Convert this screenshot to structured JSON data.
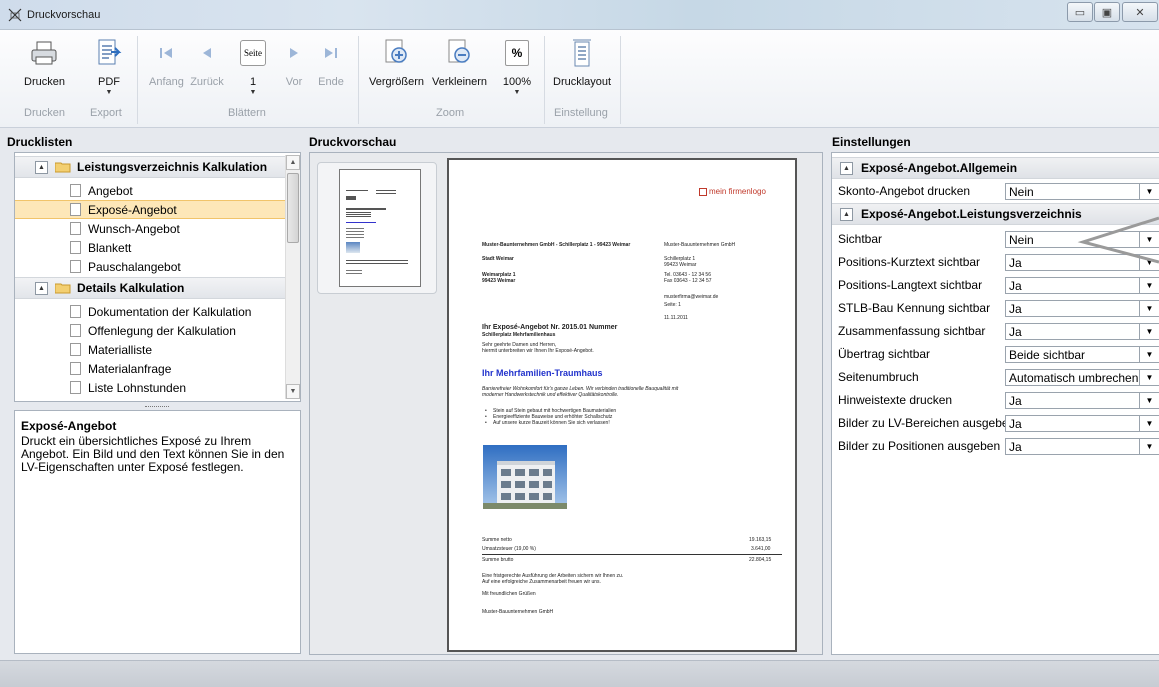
{
  "window": {
    "title": "Druckvorschau"
  },
  "ribbon": {
    "drucken": "Drucken",
    "pdf": "PDF",
    "anfang": "Anfang",
    "zurueck": "Zurück",
    "seite_icon": "Seite",
    "seite_value": "1",
    "vor": "Vor",
    "ende": "Ende",
    "vergroessern": "Vergrößern",
    "verkleinern": "Verkleinern",
    "zoom_icon": "%",
    "zoom_value": "100%",
    "drucklayout": "Drucklayout",
    "groups": {
      "drucken": "Drucken",
      "export": "Export",
      "blaettern": "Blättern",
      "zoom": "Zoom",
      "einstellung": "Einstellung"
    }
  },
  "drucklisten": {
    "title": "Drucklisten",
    "group1": "Leistungsverzeichnis Kalkulation",
    "group1_items": [
      "Angebot",
      "Exposé-Angebot",
      "Wunsch-Angebot",
      "Blankett",
      "Pauschalangebot"
    ],
    "group2": "Details Kalkulation",
    "group2_items": [
      "Dokumentation der Kalkulation",
      "Offenlegung der Kalkulation",
      "Materialliste",
      "Materialanfrage",
      "Liste Lohnstunden"
    ]
  },
  "description": {
    "title": "Exposé-Angebot",
    "text": "Druckt ein übersichtliches Exposé zu Ihrem Angebot. Ein Bild und den Text können Sie in den LV-Eigenschaften unter Exposé festlegen."
  },
  "preview": {
    "title": "Druckvorschau",
    "logo": "mein firmenlogo",
    "sender_line": "Muster-Baunternehmen GmbH - Schillerplatz 1 - 99423 Weimar",
    "company": "Muster-Bauunternehmen GmbH",
    "addr_street": "Schillerplatz 1",
    "addr_city": "99423 Weimar",
    "tel": "Tel.   03643 - 12 34 56",
    "fax": "Fax    03643 - 12 34 57",
    "email": "musterfirma@weimar.de",
    "page": "Seite: 1",
    "date": "11.11.2011",
    "recipient1": "Stadt Weimar",
    "recipient2": "Weimarplatz 1",
    "recipient3": "99423 Weimar",
    "offer_title": "Ihr Exposé-Angebot Nr. 2015.01 Nummer",
    "offer_sub": "Schillerplatz Mehrfamilienhaus",
    "salutation": "Sehr geehrte Damen und Herren,",
    "intro": "hiermit unterbreiten wir Ihnen Ihr Exposé-Angebot.",
    "headline": "Ihr Mehrfamilien-Traumhaus",
    "body1": "Barrierefreier Wohnkomfort für's ganze Leben. Wir verbinden traditionelle Bauqualität mit",
    "body2": "moderner Handwerkstechnik und effektiver Qualitätskontrolle.",
    "bullets": [
      "Stein auf Stein gebaut mit hochwertigen Baumaterialien",
      "Energieeffiziente Bauweise und erhöhter Schallschutz",
      "Auf unsere kurze Bauzeit können Sie sich verlassen!"
    ],
    "sum_net_label": "Summe netto",
    "sum_net": "19.163,15",
    "vat_label": "Umsatzsteuer (19,00 %)",
    "vat": "3.641,00",
    "sum_gross_label": "Summe brutto",
    "sum_gross": "22.804,15",
    "closing1": "Eine fristgerechte Ausführung der Arbeiten sichern wir Ihnen zu.",
    "closing2": "Auf eine erfolgreiche Zusammenarbeit freuen wir uns.",
    "greeting": "Mit freundlichen Grüßen",
    "signature": "Muster-Bauunternehmen GmbH"
  },
  "settings": {
    "title": "Einstellungen",
    "group1": "Exposé-Angebot.Allgemein",
    "group1_rows": [
      {
        "label": "Skonto-Angebot drucken",
        "value": "Nein"
      }
    ],
    "group2": "Exposé-Angebot.Leistungsverzeichnis",
    "group2_rows": [
      {
        "label": "Sichtbar",
        "value": "Nein"
      },
      {
        "label": "Positions-Kurztext sichtbar",
        "value": "Ja"
      },
      {
        "label": "Positions-Langtext sichtbar",
        "value": "Ja"
      },
      {
        "label": "STLB-Bau Kennung sichtbar",
        "value": "Ja"
      },
      {
        "label": "Zusammenfassung sichtbar",
        "value": "Ja"
      },
      {
        "label": "Übertrag sichtbar",
        "value": "Beide sichtbar"
      },
      {
        "label": "Seitenumbruch",
        "value": "Automatisch umbrechen"
      },
      {
        "label": "Hinweistexte drucken",
        "value": "Ja"
      },
      {
        "label": "Bilder zu LV-Bereichen ausgeber",
        "value": "Ja"
      },
      {
        "label": "Bilder zu Positionen ausgeben",
        "value": "Ja"
      }
    ]
  }
}
